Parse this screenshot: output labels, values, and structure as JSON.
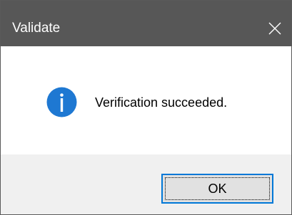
{
  "window": {
    "title": "Validate",
    "close_icon": "close-icon"
  },
  "message": {
    "icon": "info-icon",
    "text": "Verification succeeded."
  },
  "buttons": {
    "ok_label": "OK"
  },
  "colors": {
    "titlebar": "#575757",
    "info_icon": "#1e78d2",
    "button_focus_border": "#0078d7",
    "footer": "#f0f0f0"
  }
}
